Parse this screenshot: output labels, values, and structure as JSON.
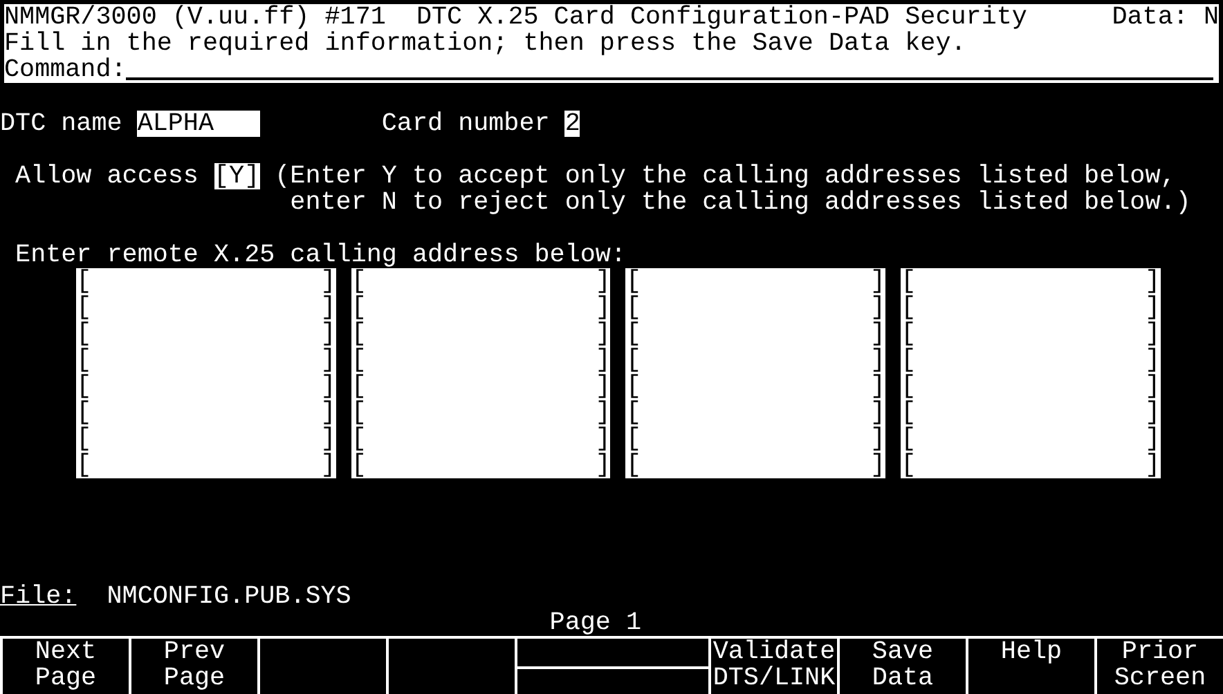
{
  "header": {
    "title": "NMMGR/3000 (V.uu.ff) #171  DTC X.25 Card Configuration-PAD Security",
    "data_flag": "Data: N",
    "instruction": "Fill in the required information; then press the Save Data key.",
    "command_label": "Command:"
  },
  "dtc": {
    "name_label": "DTC name",
    "name_value": "ALPHA",
    "card_label": "Card number",
    "card_value": "2"
  },
  "access": {
    "label": "Allow access",
    "value": "[Y]",
    "help_lines": [
      "(Enter Y to accept only the calling addresses listed below,",
      "enter N to reject only the calling addresses listed below.)"
    ]
  },
  "addresses": {
    "label": "Enter remote X.25 calling address below:",
    "open_bracket": "[",
    "close_bracket": "]",
    "columns": [
      {
        "slots": [
          {
            "kind": "empty"
          },
          {
            "kind": "empty"
          },
          {
            "kind": "empty"
          },
          {
            "kind": "empty"
          },
          {
            "kind": "empty"
          },
          {
            "kind": "empty"
          },
          {
            "kind": "empty"
          },
          {
            "kind": "empty"
          }
        ]
      },
      {
        "slots": [
          {
            "kind": "empty"
          },
          {
            "kind": "empty"
          },
          {
            "kind": "empty"
          },
          {
            "kind": "empty"
          },
          {
            "kind": "empty"
          },
          {
            "kind": "empty"
          },
          {
            "kind": "empty"
          },
          {
            "kind": "empty"
          }
        ]
      },
      {
        "slots": [
          {
            "kind": "empty"
          },
          {
            "kind": "empty"
          },
          {
            "kind": "empty"
          },
          {
            "kind": "empty"
          },
          {
            "kind": "empty"
          },
          {
            "kind": "empty"
          },
          {
            "kind": "empty"
          },
          {
            "kind": "empty"
          }
        ]
      },
      {
        "slots": [
          {
            "kind": "empty"
          },
          {
            "kind": "empty"
          },
          {
            "kind": "empty"
          },
          {
            "kind": "empty"
          },
          {
            "kind": "empty"
          },
          {
            "kind": "empty"
          },
          {
            "kind": "empty"
          },
          {
            "kind": "empty"
          }
        ]
      }
    ]
  },
  "file": {
    "label": "File:",
    "value": "NMCONFIG.PUB.SYS"
  },
  "page_indicator": "Page 1",
  "softkeys": [
    {
      "kind": "label",
      "lines": [
        "Next",
        "Page"
      ]
    },
    {
      "kind": "label",
      "lines": [
        "Prev",
        "Page"
      ]
    },
    {
      "kind": "blank"
    },
    {
      "kind": "blank"
    },
    {
      "kind": "split"
    },
    {
      "kind": "label",
      "lines": [
        "Validate",
        "DTS/LINK"
      ]
    },
    {
      "kind": "label",
      "lines": [
        "Save",
        "Data"
      ]
    },
    {
      "kind": "label",
      "lines": [
        "Help"
      ]
    },
    {
      "kind": "label",
      "lines": [
        "Prior",
        "Screen"
      ]
    }
  ]
}
